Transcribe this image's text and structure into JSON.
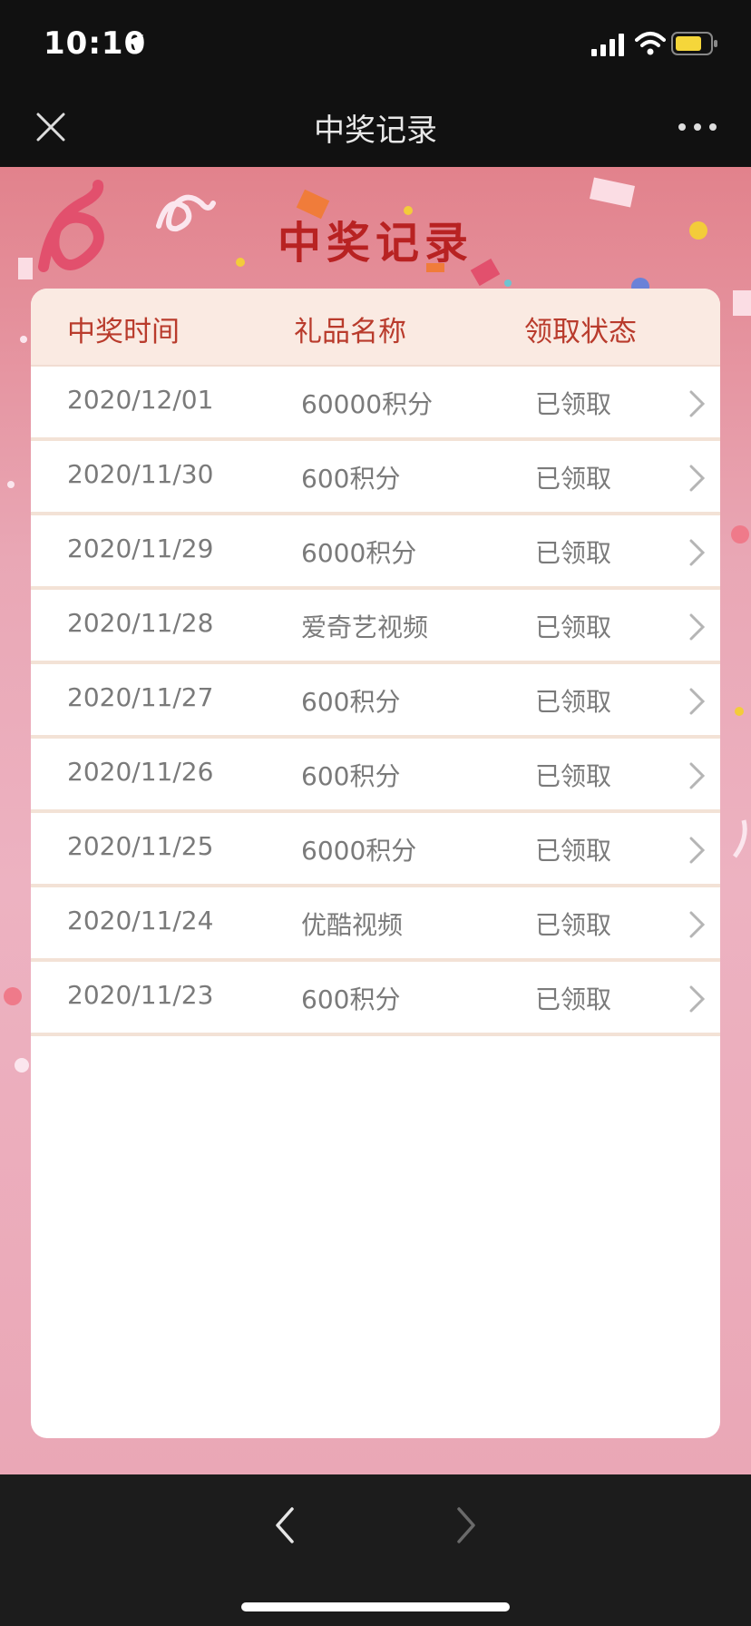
{
  "status_bar": {
    "time": "10:10"
  },
  "nav": {
    "title": "中奖记录"
  },
  "banner": {
    "title": "中奖记录"
  },
  "table": {
    "headers": [
      "中奖时间",
      "礼品名称",
      "领取状态"
    ],
    "rows": [
      {
        "date": "2020/12/01",
        "gift": "60000积分",
        "status": "已领取"
      },
      {
        "date": "2020/11/30",
        "gift": "600积分",
        "status": "已领取"
      },
      {
        "date": "2020/11/29",
        "gift": "6000积分",
        "status": "已领取"
      },
      {
        "date": "2020/11/28",
        "gift": "爱奇艺视频",
        "status": "已领取"
      },
      {
        "date": "2020/11/27",
        "gift": "600积分",
        "status": "已领取"
      },
      {
        "date": "2020/11/26",
        "gift": "600积分",
        "status": "已领取"
      },
      {
        "date": "2020/11/25",
        "gift": "6000积分",
        "status": "已领取"
      },
      {
        "date": "2020/11/24",
        "gift": "优酷视频",
        "status": "已领取"
      },
      {
        "date": "2020/11/23",
        "gift": "600积分",
        "status": "已领取"
      }
    ]
  },
  "colors": {
    "accent_red": "#b82222",
    "header_bg": "#faeae2",
    "page_bg": "#e9a7b5"
  }
}
